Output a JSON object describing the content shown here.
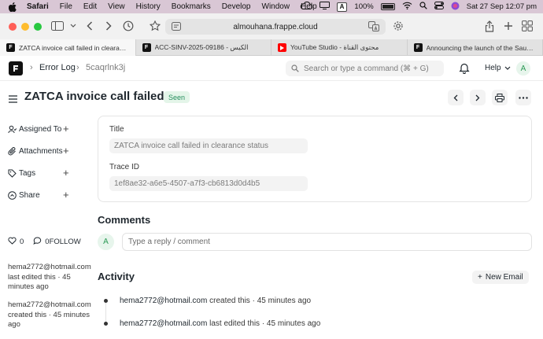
{
  "menubar": {
    "app_name": "Safari",
    "items": [
      "File",
      "Edit",
      "View",
      "History",
      "Bookmarks",
      "Develop",
      "Window",
      "Help"
    ],
    "input_badge": "A",
    "battery": "100%",
    "datetime": "Sat 27 Sep  12:07 pm"
  },
  "browser": {
    "url": "almouhana.frappe.cloud",
    "tabs": [
      {
        "title": "ZATCA invoice call failed in clearance...",
        "favicon": "frappe",
        "favicon_color": "#111111",
        "active": true
      },
      {
        "title": "ACC-SINV-2025-09186 - الكيس",
        "favicon": "frappe",
        "favicon_color": "#111111",
        "active": false
      },
      {
        "title": "YouTube Studio - محتوى القناة",
        "favicon": "youtube",
        "favicon_color": "#ff0000",
        "active": false
      },
      {
        "title": "Announcing the launch of the Saudi Z...",
        "favicon": "frappe",
        "favicon_color": "#111111",
        "active": false
      }
    ]
  },
  "navbar": {
    "breadcrumb_doctype": "Error Log",
    "breadcrumb_doc": "5caqrlnk3j",
    "search_placeholder": "Search or type a command (⌘ + G)",
    "help_label": "Help",
    "avatar_letter": "A"
  },
  "page": {
    "title": "ZATCA invoice call failed...",
    "status_badge": "Seen"
  },
  "sidebar": {
    "items": [
      {
        "label": "Assigned To",
        "icon": "assign-icon"
      },
      {
        "label": "Attachments",
        "icon": "paperclip-icon"
      },
      {
        "label": "Tags",
        "icon": "tag-icon"
      },
      {
        "label": "Share",
        "icon": "share-icon"
      }
    ],
    "likes": "0",
    "comments_follow": "0FOLLOW",
    "activity": [
      {
        "user": "hema2772@hotmail.com",
        "action": "last edited this · 45 minutes ago"
      },
      {
        "user": "hema2772@hotmail.com",
        "action": "created this · 45 minutes ago"
      }
    ]
  },
  "form": {
    "title_label": "Title",
    "title_value": "ZATCA invoice call failed in clearance status",
    "trace_label": "Trace ID",
    "trace_value": "1ef8ae32-a6e5-4507-a7f3-cb6813d0d4b5"
  },
  "comments": {
    "heading": "Comments",
    "avatar_letter": "A",
    "placeholder": "Type a reply / comment"
  },
  "activity": {
    "heading": "Activity",
    "new_email_label": "New Email",
    "items": [
      {
        "user": "hema2772@hotmail.com",
        "text": "created this · 45 minutes ago"
      },
      {
        "user": "hema2772@hotmail.com",
        "text": "last edited this · 45 minutes ago"
      }
    ]
  },
  "colors": {
    "menubar_bg": "#d9c7d5",
    "badge_green": "#278f5e",
    "traffic_red": "#ff5f57",
    "traffic_yellow": "#febc2e",
    "traffic_green": "#28c840"
  }
}
